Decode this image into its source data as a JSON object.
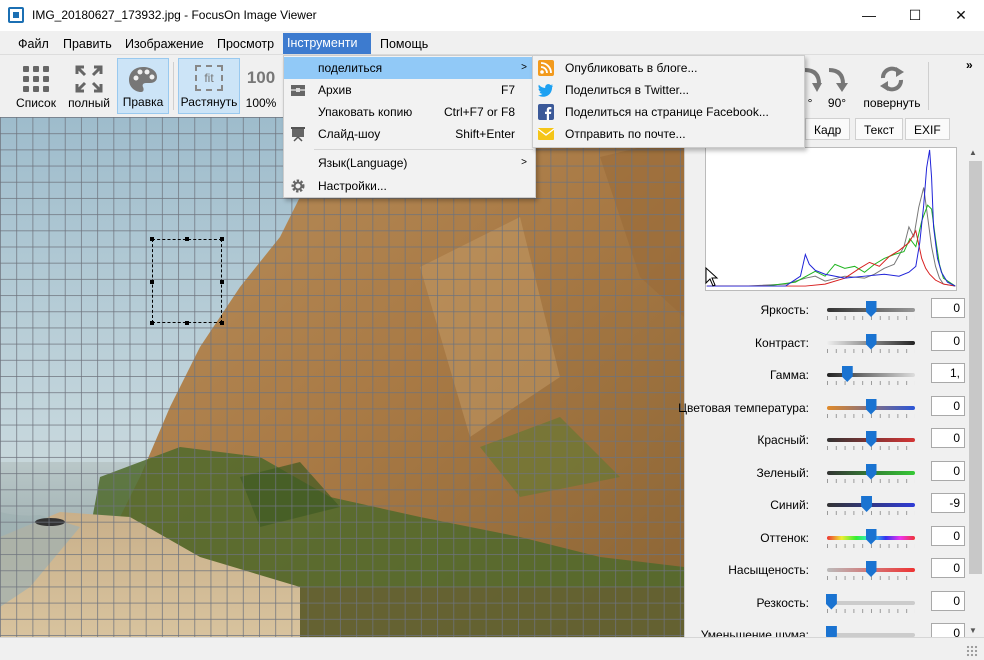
{
  "window": {
    "title": "IMG_20180627_173932.jpg - FocusOn Image Viewer",
    "minimize": "—",
    "maximize": "☐",
    "close": "✕"
  },
  "menubar": [
    "Файл",
    "Править",
    "Изображение",
    "Просмотр",
    "Інструменти",
    "Помощь"
  ],
  "toolbar": {
    "list_label": "Список",
    "full_label": "полный",
    "edit_label": "Правка",
    "fit_label": "Растянуть",
    "fit_icon_text": "fit",
    "zoom_icon_text": "100",
    "zoom_label": "100%",
    "rotate_ccw_label": "°",
    "rotate_cw_label": "90°",
    "rotate_cw_icon_text": "90",
    "rotate_label": "повернуть",
    "overflow": "»"
  },
  "tools_menu": {
    "share": "поделиться",
    "archive": "Архив",
    "archive_shortcut": "F7",
    "pack": "Упаковать копию",
    "pack_shortcut": "Ctrl+F7 or F8",
    "slideshow": "Слайд-шоу",
    "slideshow_shortcut": "Shift+Enter",
    "language": "Язык(Language)",
    "settings": "Настройки...",
    "arrow": ">"
  },
  "share_menu": {
    "blog": "Опубликовать в блоге...",
    "twitter": "Поделиться в Twitter...",
    "facebook": "Поделиться на странице Facebook...",
    "mail": "Отправить по почте..."
  },
  "panel_tabs": [
    "Кадр",
    "Текст",
    "EXIF"
  ],
  "sliders": [
    {
      "label": "Яркость:",
      "value": "0",
      "level": 0.5,
      "track": "linear-gradient(90deg,#333,#999)"
    },
    {
      "label": "Контраст:",
      "value": "0",
      "level": 0.5,
      "track": "linear-gradient(90deg,#eee,#222)"
    },
    {
      "label": "Гамма:",
      "value": "1,",
      "level": 0.23,
      "track": "linear-gradient(90deg,#222,#ddd)"
    },
    {
      "label": "Цветовая температура:",
      "value": "0",
      "level": 0.5,
      "track": "linear-gradient(90deg,#e08a2a,#2a55d8)"
    },
    {
      "label": "Красный:",
      "value": "0",
      "level": 0.5,
      "track": "linear-gradient(90deg,#333,#d43535)"
    },
    {
      "label": "Зеленый:",
      "value": "0",
      "level": 0.5,
      "track": "linear-gradient(90deg,#333,#35c935)"
    },
    {
      "label": "Синий:",
      "value": "-9",
      "level": 0.45,
      "track": "linear-gradient(90deg,#333,#2f3bd6)"
    },
    {
      "label": "Оттенок:",
      "value": "0",
      "level": 0.5,
      "track": "linear-gradient(90deg,#e33,#ee3,#3e3,#3ee,#33e,#e3e,#e33)"
    },
    {
      "label": "Насыщеность:",
      "value": "0",
      "level": 0.5,
      "track": "linear-gradient(90deg,#bbb,#e33)"
    },
    {
      "label": "Резкость:",
      "value": "0",
      "level": 0.05,
      "track": "linear-gradient(90deg,#ccc,#ccc)"
    },
    {
      "label": "Уменьшение шума:",
      "value": "0",
      "level": 0.05,
      "track": "linear-gradient(90deg,#ccc,#ccc)"
    }
  ],
  "colors": {
    "accent": "#1a73d1",
    "menu_active": "#3d7bcf",
    "menu_highlight": "#91c9f7",
    "histogram_blue": "#1f22d8",
    "histogram_green": "#1fb41f",
    "histogram_red": "#d81f1f",
    "histogram_gray": "#777777"
  }
}
